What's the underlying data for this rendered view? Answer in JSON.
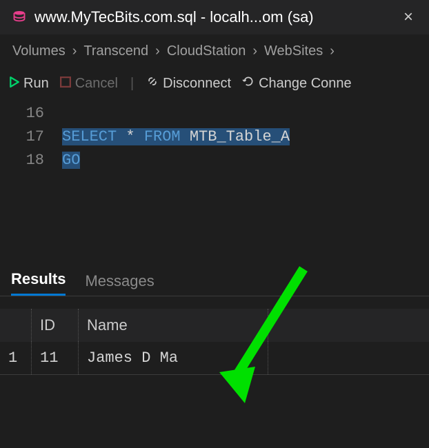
{
  "tab": {
    "title": "www.MyTecBits.com.sql - localh...om (sa)"
  },
  "breadcrumbs": [
    "Volumes",
    "Transcend",
    "CloudStation",
    "WebSites"
  ],
  "toolbar": {
    "run": "Run",
    "cancel": "Cancel",
    "disconnect": "Disconnect",
    "change": "Change Conne"
  },
  "editor": {
    "lines": [
      {
        "num": "16",
        "code": ""
      },
      {
        "num": "17",
        "code": "SELECT * FROM MTB_Table_A"
      },
      {
        "num": "18",
        "code": "GO"
      }
    ]
  },
  "results": {
    "tabs": {
      "results": "Results",
      "messages": "Messages"
    },
    "headers": {
      "id": "ID",
      "name": "Name"
    },
    "rows": [
      {
        "n": "1",
        "id": "11",
        "name": "James D Ma"
      }
    ]
  }
}
